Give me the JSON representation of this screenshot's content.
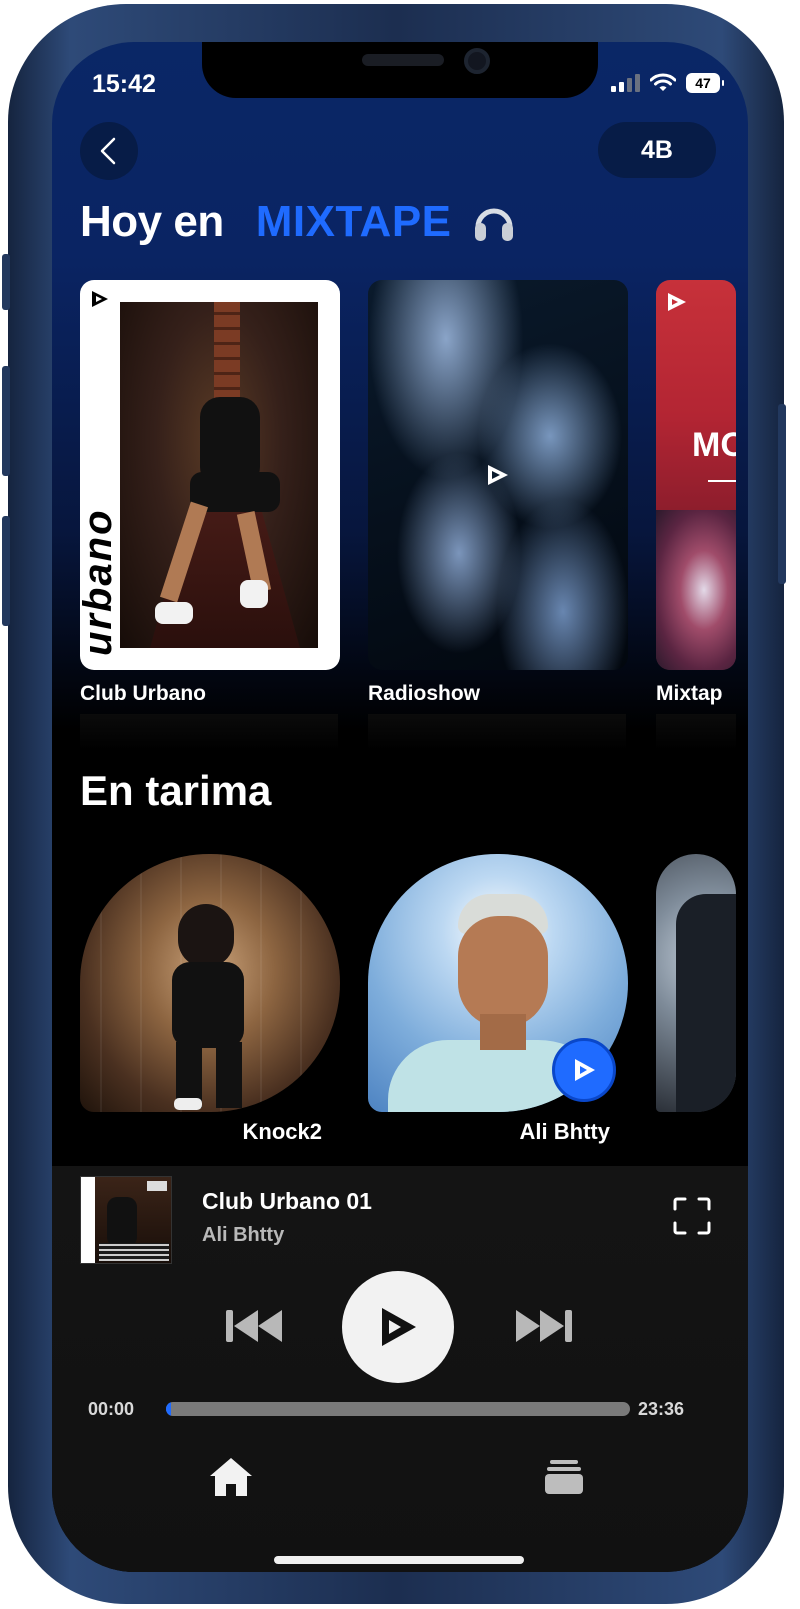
{
  "status": {
    "time": "15:42",
    "battery": "47"
  },
  "header": {
    "user_initials": "4B"
  },
  "hero": {
    "title_prefix": "Hoy en",
    "title_brand": "MIXTAPE"
  },
  "shows": [
    {
      "label": "Club Urbano",
      "cover_text": "urbano"
    },
    {
      "label": "Radioshow"
    },
    {
      "label": "Mixtap",
      "cover_text": "MO"
    }
  ],
  "stage": {
    "title": "En tarima",
    "artists": [
      {
        "name": "Knock2"
      },
      {
        "name": "Ali Bhtty"
      },
      {
        "name": ""
      }
    ]
  },
  "player": {
    "track_title": "Club Urbano 01",
    "track_artist": "Ali Bhtty",
    "time_current": "00:00",
    "time_total": "23:36",
    "progress": 0.005
  },
  "icons": {
    "back": "chevron-left-icon",
    "headphones": "headphones-icon",
    "play": "play-icon",
    "prev": "skip-back-icon",
    "next": "skip-forward-icon",
    "fullscreen": "fullscreen-icon",
    "home": "home-icon",
    "library": "library-icon"
  },
  "colors": {
    "accent": "#1f6bff",
    "background_top": "#0a2766",
    "background": "#000000"
  }
}
